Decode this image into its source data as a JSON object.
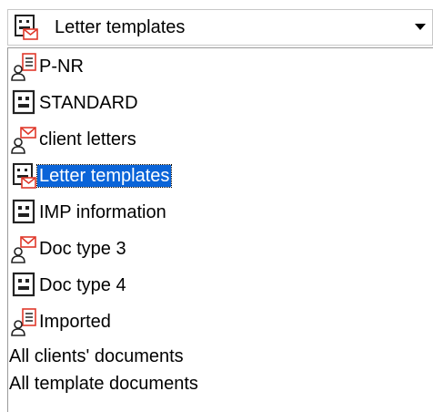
{
  "selected": {
    "label": "Letter templates",
    "icon": "letter-template-icon"
  },
  "dropdown_arrow_icon": "chevron-down-icon",
  "items": [
    {
      "label": "P-NR",
      "icon": "client-document-icon",
      "selected": false
    },
    {
      "label": "STANDARD",
      "icon": "template-icon",
      "selected": false
    },
    {
      "label": "client letters",
      "icon": "client-letter-icon",
      "selected": false
    },
    {
      "label": "Letter templates",
      "icon": "letter-template-icon",
      "selected": true
    },
    {
      "label": "IMP information",
      "icon": "template-icon",
      "selected": false
    },
    {
      "label": "Doc type 3",
      "icon": "client-letter-icon",
      "selected": false
    },
    {
      "label": "Doc type 4",
      "icon": "template-icon",
      "selected": false
    },
    {
      "label": "Imported",
      "icon": "client-document-icon",
      "selected": false
    },
    {
      "label": "All clients' documents",
      "icon": "",
      "selected": false
    },
    {
      "label": "All template documents",
      "icon": "",
      "selected": false
    }
  ],
  "colors": {
    "selection": "#0a64d8",
    "icon_outline": "#222222",
    "envelope": "#e0392b"
  }
}
